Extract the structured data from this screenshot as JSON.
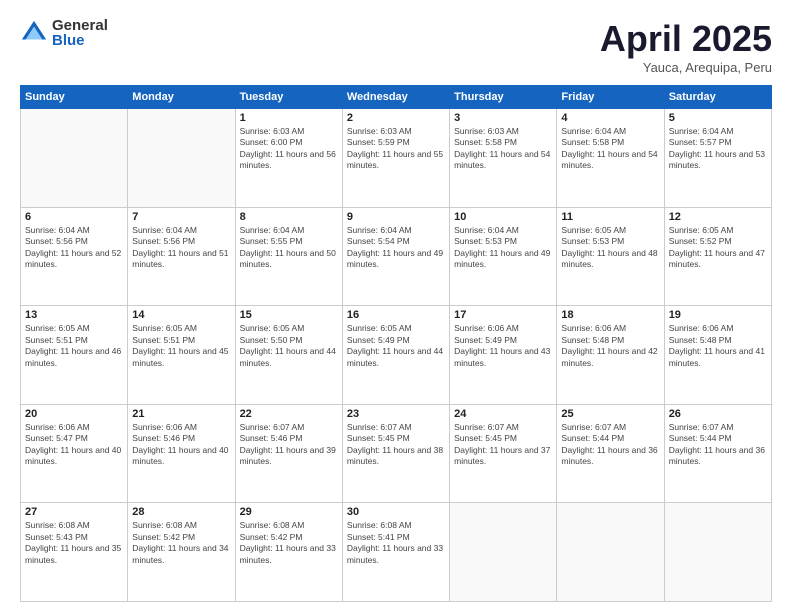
{
  "logo": {
    "general": "General",
    "blue": "Blue"
  },
  "title": "April 2025",
  "location": "Yauca, Arequipa, Peru",
  "weekdays": [
    "Sunday",
    "Monday",
    "Tuesday",
    "Wednesday",
    "Thursday",
    "Friday",
    "Saturday"
  ],
  "weeks": [
    [
      {
        "day": "",
        "info": ""
      },
      {
        "day": "",
        "info": ""
      },
      {
        "day": "1",
        "info": "Sunrise: 6:03 AM\nSunset: 6:00 PM\nDaylight: 11 hours and 56 minutes."
      },
      {
        "day": "2",
        "info": "Sunrise: 6:03 AM\nSunset: 5:59 PM\nDaylight: 11 hours and 55 minutes."
      },
      {
        "day": "3",
        "info": "Sunrise: 6:03 AM\nSunset: 5:58 PM\nDaylight: 11 hours and 54 minutes."
      },
      {
        "day": "4",
        "info": "Sunrise: 6:04 AM\nSunset: 5:58 PM\nDaylight: 11 hours and 54 minutes."
      },
      {
        "day": "5",
        "info": "Sunrise: 6:04 AM\nSunset: 5:57 PM\nDaylight: 11 hours and 53 minutes."
      }
    ],
    [
      {
        "day": "6",
        "info": "Sunrise: 6:04 AM\nSunset: 5:56 PM\nDaylight: 11 hours and 52 minutes."
      },
      {
        "day": "7",
        "info": "Sunrise: 6:04 AM\nSunset: 5:56 PM\nDaylight: 11 hours and 51 minutes."
      },
      {
        "day": "8",
        "info": "Sunrise: 6:04 AM\nSunset: 5:55 PM\nDaylight: 11 hours and 50 minutes."
      },
      {
        "day": "9",
        "info": "Sunrise: 6:04 AM\nSunset: 5:54 PM\nDaylight: 11 hours and 49 minutes."
      },
      {
        "day": "10",
        "info": "Sunrise: 6:04 AM\nSunset: 5:53 PM\nDaylight: 11 hours and 49 minutes."
      },
      {
        "day": "11",
        "info": "Sunrise: 6:05 AM\nSunset: 5:53 PM\nDaylight: 11 hours and 48 minutes."
      },
      {
        "day": "12",
        "info": "Sunrise: 6:05 AM\nSunset: 5:52 PM\nDaylight: 11 hours and 47 minutes."
      }
    ],
    [
      {
        "day": "13",
        "info": "Sunrise: 6:05 AM\nSunset: 5:51 PM\nDaylight: 11 hours and 46 minutes."
      },
      {
        "day": "14",
        "info": "Sunrise: 6:05 AM\nSunset: 5:51 PM\nDaylight: 11 hours and 45 minutes."
      },
      {
        "day": "15",
        "info": "Sunrise: 6:05 AM\nSunset: 5:50 PM\nDaylight: 11 hours and 44 minutes."
      },
      {
        "day": "16",
        "info": "Sunrise: 6:05 AM\nSunset: 5:49 PM\nDaylight: 11 hours and 44 minutes."
      },
      {
        "day": "17",
        "info": "Sunrise: 6:06 AM\nSunset: 5:49 PM\nDaylight: 11 hours and 43 minutes."
      },
      {
        "day": "18",
        "info": "Sunrise: 6:06 AM\nSunset: 5:48 PM\nDaylight: 11 hours and 42 minutes."
      },
      {
        "day": "19",
        "info": "Sunrise: 6:06 AM\nSunset: 5:48 PM\nDaylight: 11 hours and 41 minutes."
      }
    ],
    [
      {
        "day": "20",
        "info": "Sunrise: 6:06 AM\nSunset: 5:47 PM\nDaylight: 11 hours and 40 minutes."
      },
      {
        "day": "21",
        "info": "Sunrise: 6:06 AM\nSunset: 5:46 PM\nDaylight: 11 hours and 40 minutes."
      },
      {
        "day": "22",
        "info": "Sunrise: 6:07 AM\nSunset: 5:46 PM\nDaylight: 11 hours and 39 minutes."
      },
      {
        "day": "23",
        "info": "Sunrise: 6:07 AM\nSunset: 5:45 PM\nDaylight: 11 hours and 38 minutes."
      },
      {
        "day": "24",
        "info": "Sunrise: 6:07 AM\nSunset: 5:45 PM\nDaylight: 11 hours and 37 minutes."
      },
      {
        "day": "25",
        "info": "Sunrise: 6:07 AM\nSunset: 5:44 PM\nDaylight: 11 hours and 36 minutes."
      },
      {
        "day": "26",
        "info": "Sunrise: 6:07 AM\nSunset: 5:44 PM\nDaylight: 11 hours and 36 minutes."
      }
    ],
    [
      {
        "day": "27",
        "info": "Sunrise: 6:08 AM\nSunset: 5:43 PM\nDaylight: 11 hours and 35 minutes."
      },
      {
        "day": "28",
        "info": "Sunrise: 6:08 AM\nSunset: 5:42 PM\nDaylight: 11 hours and 34 minutes."
      },
      {
        "day": "29",
        "info": "Sunrise: 6:08 AM\nSunset: 5:42 PM\nDaylight: 11 hours and 33 minutes."
      },
      {
        "day": "30",
        "info": "Sunrise: 6:08 AM\nSunset: 5:41 PM\nDaylight: 11 hours and 33 minutes."
      },
      {
        "day": "",
        "info": ""
      },
      {
        "day": "",
        "info": ""
      },
      {
        "day": "",
        "info": ""
      }
    ]
  ]
}
